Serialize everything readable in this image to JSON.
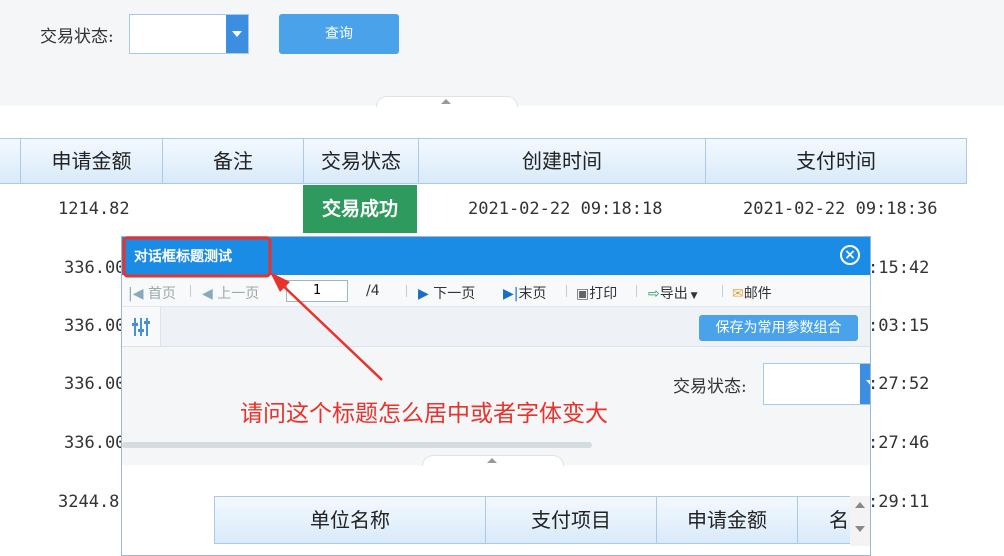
{
  "filter": {
    "status_label": "交易状态:",
    "status_value": "",
    "query_button": "查询"
  },
  "table": {
    "headers": [
      "申请金额",
      "备注",
      "交易状态",
      "创建时间",
      "支付时间"
    ],
    "amounts": [
      "1214.82",
      "336.00",
      "336.00",
      "336.00",
      "336.00",
      "3244.8"
    ],
    "row1": {
      "status": "交易成功",
      "created": "2021-02-22 09:18:18",
      "paid": "2021-02-22 09:18:36"
    },
    "paid_times": [
      ":15:42",
      ":03:15",
      ":27:52",
      ":27:46",
      ":29:11"
    ]
  },
  "dialog": {
    "title": "对话框标题测试",
    "toolbar": {
      "first": "首页",
      "prev": "上一页",
      "page": "1",
      "total": "/4",
      "next": "下一页",
      "last": "末页",
      "print": "打印",
      "export": "导出",
      "mail": "邮件"
    },
    "save_button": "保存为常用参数组合",
    "status_label": "交易状态:",
    "headers": [
      "单位名称",
      "支付项目",
      "申请金额",
      "名"
    ]
  },
  "annotation": "请问这个标题怎么居中或者字体变大",
  "colors": {
    "title_bar": "#1a8ce6",
    "status_success": "#2e9a5e",
    "annotation_red": "#e8322b",
    "button_blue": "#4aa3ea"
  }
}
